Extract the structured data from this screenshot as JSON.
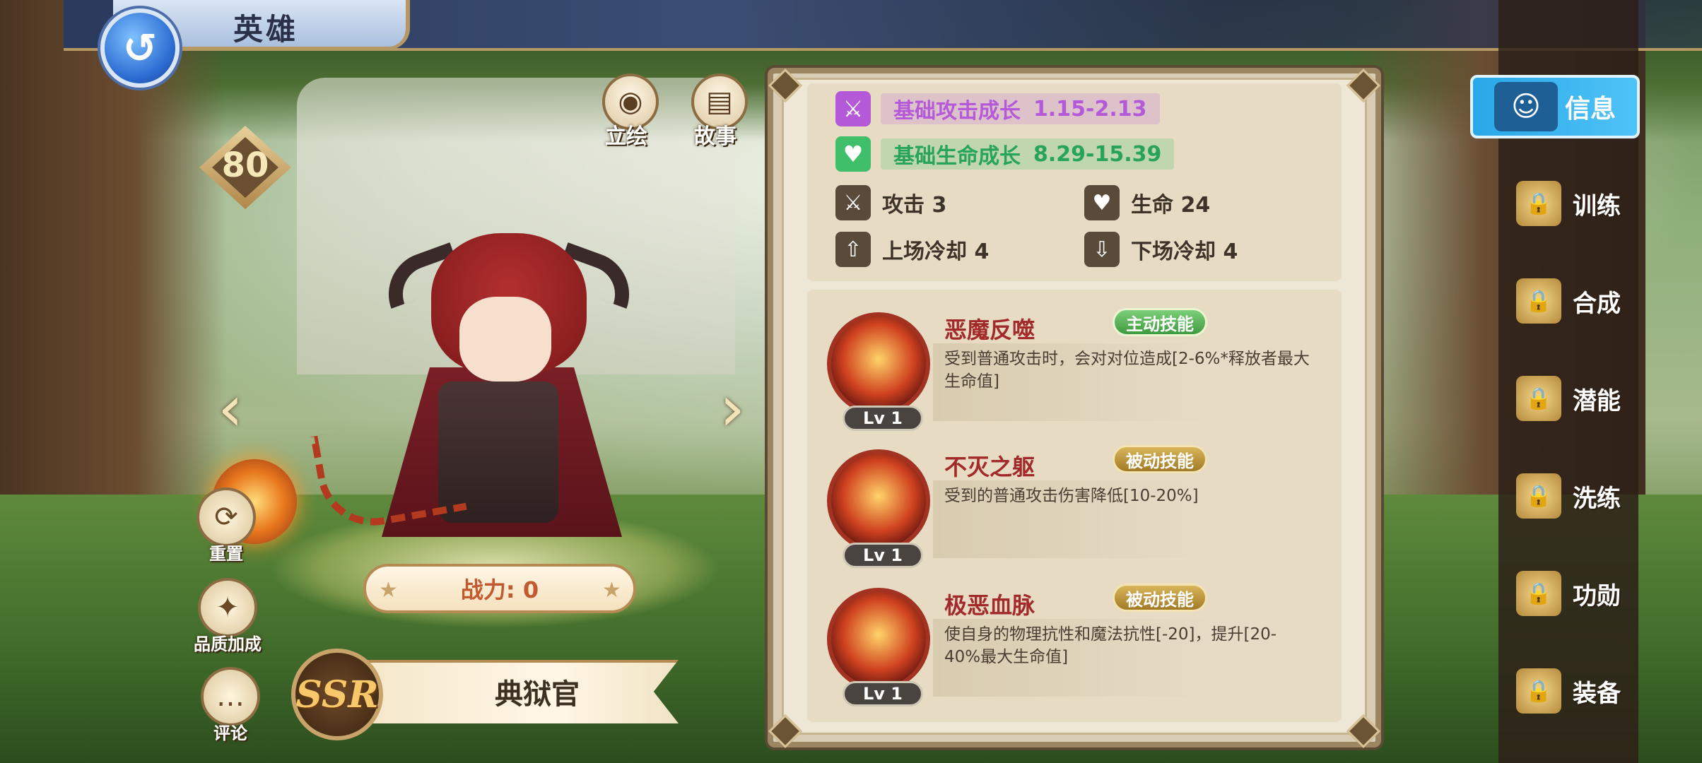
{
  "header": {
    "title": "英雄"
  },
  "hero": {
    "level": "80",
    "power_label": "战力: 0",
    "rarity": "SSR",
    "name": "典狱官"
  },
  "top_buttons": [
    {
      "label": "立绘",
      "icon": "eye-icon"
    },
    {
      "label": "故事",
      "icon": "book-icon"
    }
  ],
  "left_buttons": {
    "reset": "重置",
    "quality": "品质加成",
    "comment": "评论"
  },
  "stats": {
    "atk_growth_label": "基础攻击成长",
    "atk_growth_value": "1.15-2.13",
    "hp_growth_label": "基础生命成长",
    "hp_growth_value": "8.29-15.39",
    "attack": "攻击 3",
    "life": "生命 24",
    "enter_cd": "上场冷却 4",
    "exit_cd": "下场冷却 4"
  },
  "skills": [
    {
      "name": "恶魔反噬",
      "tag": "主动技能",
      "level": "Lv 1",
      "desc": "受到普通攻击时，会对对位造成[2-6%*释放者最大生命值]"
    },
    {
      "name": "不灭之躯",
      "tag": "被动技能",
      "level": "Lv 1",
      "desc": "受到的普通攻击伤害降低[10-20%]"
    },
    {
      "name": "极恶血脉",
      "tag": "被动技能",
      "level": "Lv 1",
      "desc": "使自身的物理抗性和魔法抗性[-20]，提升[20-40%最大生命值]"
    }
  ],
  "menu": {
    "active": "信息",
    "items": [
      "训练",
      "合成",
      "潜能",
      "洗练",
      "功勋",
      "装备"
    ]
  },
  "colors": {
    "atk_growth": "#b45ad8",
    "hp_growth": "#3fbf6a",
    "menu_active": "#29a7e8"
  }
}
